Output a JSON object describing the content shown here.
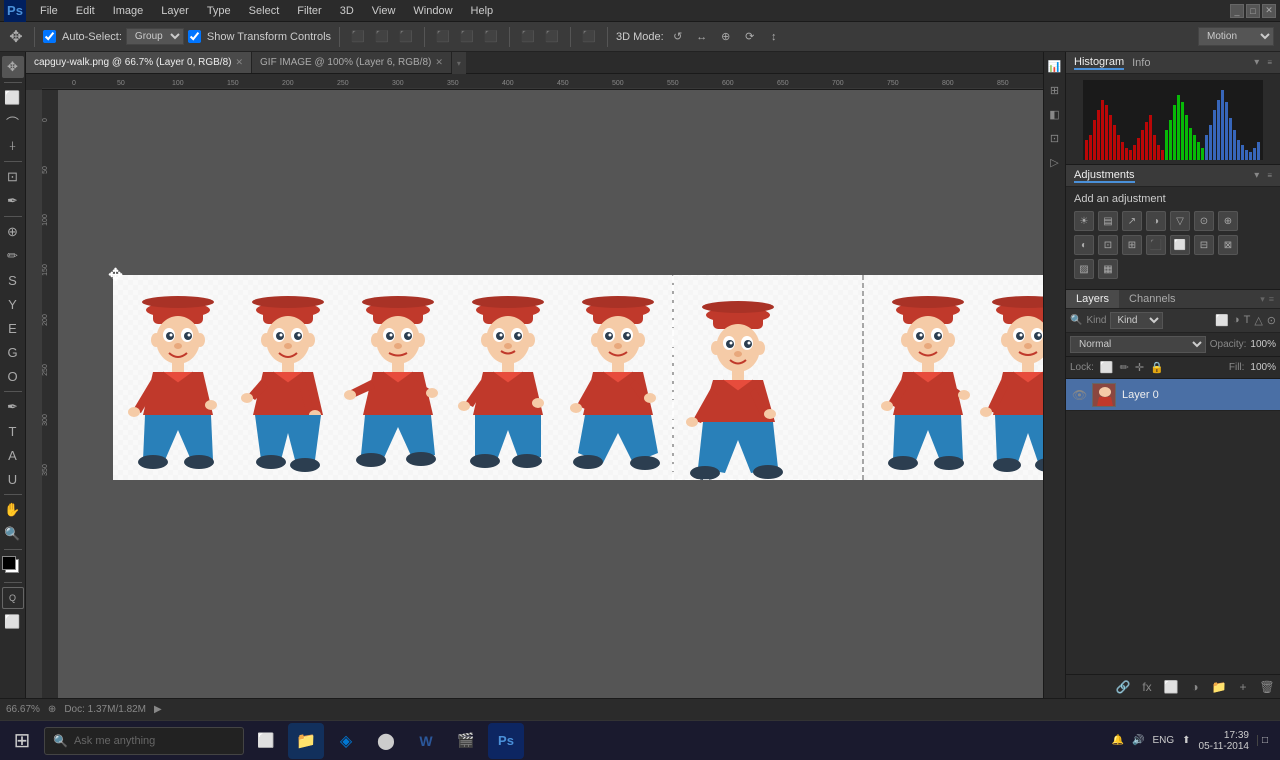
{
  "app": {
    "logo": "Ps",
    "title": "Adobe Photoshop"
  },
  "menu": {
    "items": [
      "File",
      "Edit",
      "Image",
      "Layer",
      "Type",
      "Select",
      "Filter",
      "3D",
      "View",
      "Window",
      "Help"
    ]
  },
  "options_bar": {
    "tool_label": "Auto-Select:",
    "group_select": "Group",
    "show_transform": "Show Transform Controls",
    "workspace": "Motion",
    "align_icons": [
      "⊡",
      "⊟",
      "⊠",
      "⊡",
      "⊞",
      "⊡",
      "⊡",
      "⊡",
      "⊡"
    ],
    "mode_label": "3D Mode:"
  },
  "tabs": [
    {
      "label": "capguy-walk.png @ 66.7% (Layer 0, RGB/8)",
      "active": true,
      "modified": true
    },
    {
      "label": "GIF IMAGE @ 100% (Layer 6, RGB/8)",
      "active": false,
      "modified": false
    }
  ],
  "canvas": {
    "zoom_level": "66.67%",
    "doc_info": "Doc: 1.37M/1.82M"
  },
  "histogram_panel": {
    "tabs": [
      "Histogram",
      "Info"
    ],
    "active_tab": "Histogram"
  },
  "adjustments_panel": {
    "title": "Adjustments",
    "subtitle": "Add an adjustment"
  },
  "layers_panel": {
    "title": "Layers",
    "tabs": [
      "Layers",
      "Channels"
    ],
    "active_tab": "Layers",
    "search_label": "Kind",
    "blend_mode": "Normal",
    "opacity_label": "Opacity:",
    "opacity_value": "100%",
    "lock_label": "Lock:",
    "fill_label": "Fill:",
    "fill_value": "100%",
    "layers": [
      {
        "name": "Layer 0",
        "visible": true,
        "active": true
      }
    ]
  },
  "status_bar": {
    "zoom": "66.67%",
    "doc_info": "Doc: 1.37M/1.82M",
    "tool_indicator": "▶"
  },
  "taskbar": {
    "start_label": "⊞",
    "search_placeholder": "Ask me anything",
    "time": "17:39",
    "date": "05-11-2014",
    "system_apps": [
      "🔊",
      "ENG",
      "⬆"
    ]
  },
  "icons": {
    "colors": {
      "accent_blue": "#4a90d9",
      "bg_dark": "#2b2b2b",
      "bg_mid": "#3a3a3a",
      "bg_light": "#4a4a4a",
      "canvas_bg": "#555555"
    }
  }
}
